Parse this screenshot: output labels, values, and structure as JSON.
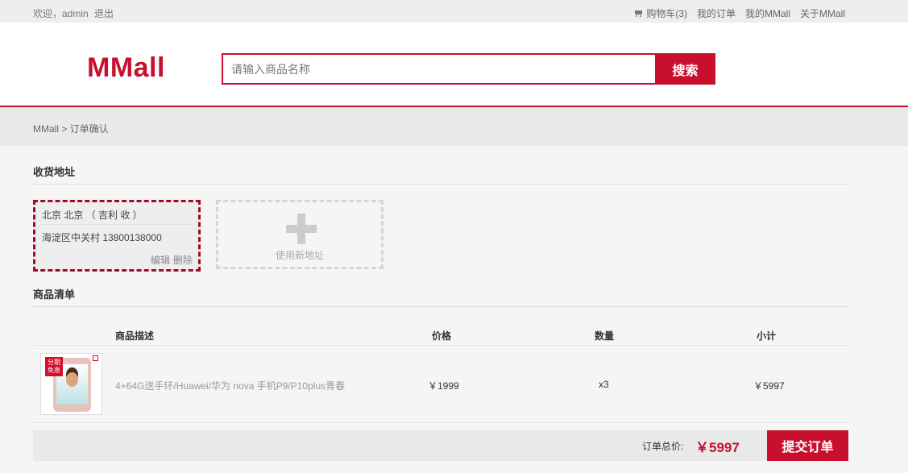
{
  "topbar": {
    "welcome": "欢迎，admin",
    "logout": "退出",
    "cart": "购物车(3)",
    "my_orders": "我的订单",
    "my_mmall": "我的MMall",
    "about": "关于MMall"
  },
  "header": {
    "logo": "MMall",
    "search_placeholder": "请输入商品名称",
    "search_button": "搜索"
  },
  "breadcrumb": {
    "text": "MMall > 订单确认"
  },
  "address": {
    "section_title": "收货地址",
    "name_line": "北京 北京 （ 吉利 收 ）",
    "detail_line": "海淀区中关村 13800138000",
    "edit": "编辑",
    "delete": "删除",
    "new_address": "使用新地址"
  },
  "products": {
    "section_title": "商品清单",
    "headers": {
      "description": "商品描述",
      "price": "价格",
      "quantity": "数量",
      "subtotal": "小计"
    },
    "items": [
      {
        "badge": "分期免息",
        "description": "4+64G送手环/Huawei/华为 nova 手机P9/P10plus青春",
        "price": "￥1999",
        "quantity": "x3",
        "subtotal": "￥5997"
      }
    ]
  },
  "order": {
    "total_label": "订单总价:",
    "total_value": "￥5997",
    "submit_button": "提交订单"
  },
  "colors": {
    "brand": "#c8102e",
    "background": "#f5f5f5"
  },
  "icons": {
    "cart": "cart-icon",
    "add_address": "plus-icon"
  }
}
